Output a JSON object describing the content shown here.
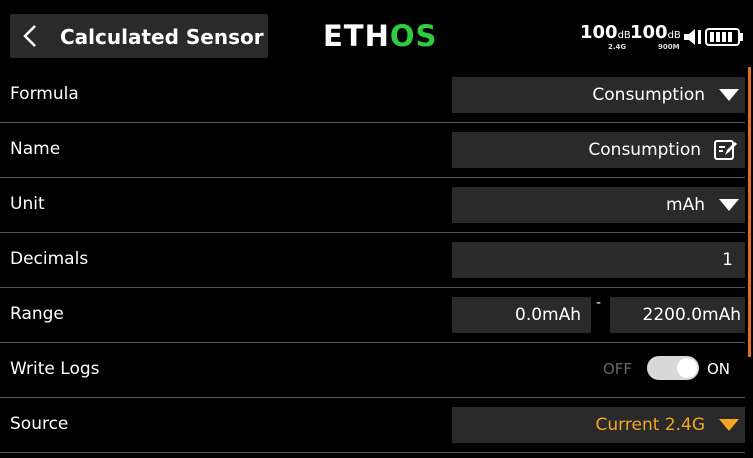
{
  "header": {
    "title": "Calculated Sensor",
    "logo_left": "ETH",
    "logo_right": "OS",
    "rssi": [
      {
        "value": "100",
        "unit": "dB",
        "band": "2.4G"
      },
      {
        "value": "100",
        "unit": "dB",
        "band": "900M"
      }
    ],
    "icons": [
      "back-chevron-icon",
      "audio-icon",
      "battery-icon"
    ]
  },
  "colors": {
    "accent": "#f5a623",
    "logo_green": "#2ecc40",
    "scrollbar": "#e07020",
    "field_bg": "#2a2a2a"
  },
  "rows": {
    "formula": {
      "label": "Formula",
      "value": "Consumption"
    },
    "name": {
      "label": "Name",
      "value": "Consumption"
    },
    "unit": {
      "label": "Unit",
      "value": "mAh"
    },
    "decimals": {
      "label": "Decimals",
      "value": "1"
    },
    "range": {
      "label": "Range",
      "min": "0.0mAh",
      "separator": "-",
      "max": "2200.0mAh"
    },
    "write_logs": {
      "label": "Write Logs",
      "off_label": "OFF",
      "on_label": "ON",
      "state": "on"
    },
    "source": {
      "label": "Source",
      "value": "Current 2.4G"
    }
  }
}
